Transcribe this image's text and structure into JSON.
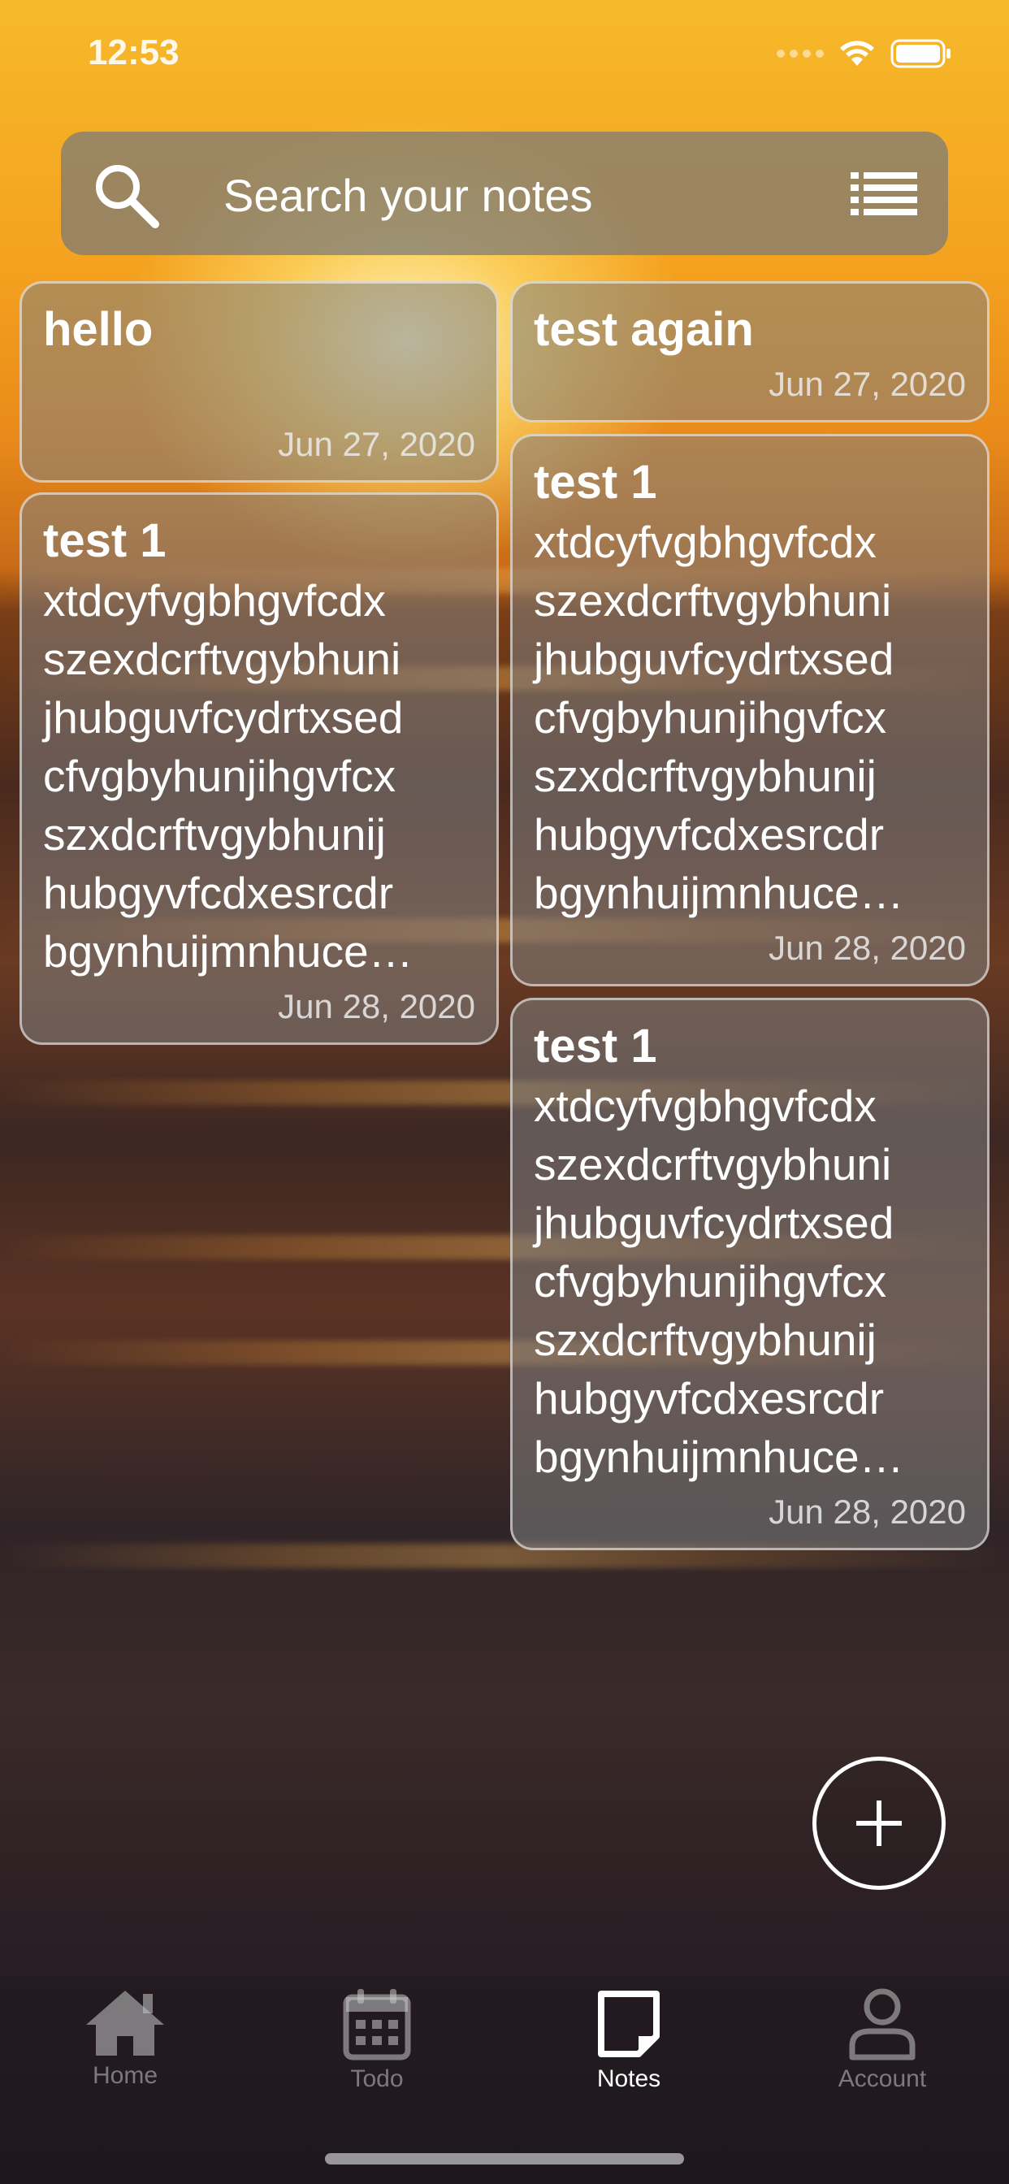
{
  "status_bar": {
    "time": "12:53"
  },
  "search": {
    "placeholder": "Search your notes"
  },
  "notes": [
    {
      "title": "hello",
      "body": "",
      "date": "Jun 27, 2020"
    },
    {
      "title": "test 1",
      "body": "xtdcyfvgbhgvfcdx\nszexdcrftvgybhuni\njhubguvfcydrtxsed\ncfvgbyhunjihgvfcx\nszxdcrftvgybhunij\nhubgyvfcdxesrcdr\nbgynhuijmnhuce…",
      "date": "Jun 28, 2020"
    },
    {
      "title": "test again",
      "body": "",
      "date": "Jun 27, 2020"
    },
    {
      "title": "test 1",
      "body": "xtdcyfvgbhgvfcdx\nszexdcrftvgybhuni\njhubguvfcydrtxsed\ncfvgbyhunjihgvfcx\nszxdcrftvgybhunij\nhubgyvfcdxesrcdr\nbgynhuijmnhuce…",
      "date": "Jun 28, 2020"
    },
    {
      "title": "test 1",
      "body": "xtdcyfvgbhgvfcdx\nszexdcrftvgybhuni\njhubguvfcydrtxsed\ncfvgbyhunjihgvfcx\nszxdcrftvgybhunij\nhubgyvfcdxesrcdr\nbgynhuijmnhuce…",
      "date": "Jun 28, 2020"
    }
  ],
  "tab_bar": {
    "items": [
      {
        "label": "Home",
        "icon": "home-icon",
        "active": false
      },
      {
        "label": "Todo",
        "icon": "calendar-icon",
        "active": false
      },
      {
        "label": "Notes",
        "icon": "note-icon",
        "active": true
      },
      {
        "label": "Account",
        "icon": "account-icon",
        "active": false
      }
    ]
  },
  "fab": {
    "icon": "plus-icon"
  }
}
